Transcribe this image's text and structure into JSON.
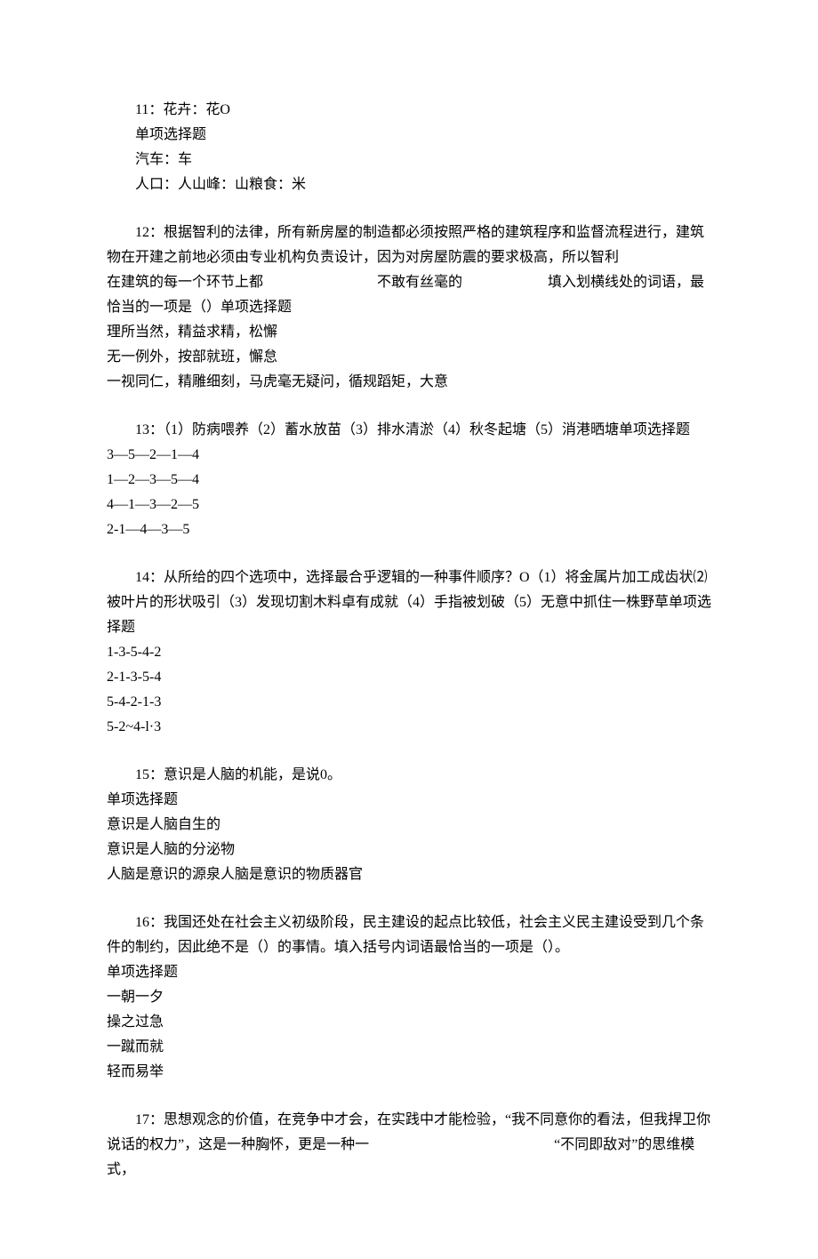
{
  "q11": {
    "l1": "11：花卉：花O",
    "l2": "单项选择题",
    "l3": "汽车：车",
    "l4": "人口：人山峰：山粮食：米"
  },
  "q12": {
    "l1": "12：根据智利的法律，所有新房屋的制造都必须按照严格的建筑程序和监督流程进行，建筑物在开建之前地必须由专业机构负责设计，因为对房屋防震的要求极高，所以智利",
    "l2": "在建筑的每一个环节上都　　　　　　　　不敢有丝毫的　　　　　　填入划横线处的词语，最恰当的一项是（）单项选择题",
    "l3": "理所当然，精益求精，松懈",
    "l4": "无一例外，按部就班，懈怠",
    "l5": "一视同仁，精雕细刻，马虎毫无疑问，循规蹈矩，大意"
  },
  "q13": {
    "l1": "13：（1）防病喂养（2）蓄水放苗（3）排水清淤（4）秋冬起塘（5）消港晒塘单项选择题",
    "l2": "3—5—2—1—4",
    "l3": "1—2—3—5—4",
    "l4": "4—1—3—2—5",
    "l5": "2-1—4—3—5"
  },
  "q14": {
    "l1": "14：从所给的四个选项中，选择最合乎逻辑的一种事件顺序？O（1）将金属片加工成齿状⑵被叶片的形状吸引（3）发现切割木料卓有成就（4）手指被划破（5）无意中抓住一株野草单项选择题",
    "l2": "1-3-5-4-2",
    "l3": "2-1-3-5-4",
    "l4": "5-4-2-1-3",
    "l5": "5-2~4-l·3"
  },
  "q15": {
    "l1": "15：意识是人脑的机能，是说0。",
    "l2": "单项选择题",
    "l3": "意识是人脑自生的",
    "l4": "意识是人脑的分泌物",
    "l5": "人脑是意识的源泉人脑是意识的物质器官"
  },
  "q16": {
    "l1": "16：我国还处在社会主义初级阶段，民主建设的起点比较低，社会主义民主建设受到几个条件的制约，因此绝不是（）的事情。填入括号内词语最恰当的一项是（）。",
    "l2": "单项选择题",
    "l3": "一朝一夕",
    "l4": "操之过急",
    "l5": "一蹴而就",
    "l6": "轻而易举"
  },
  "q17": {
    "l1": "17：思想观念的价值，在竞争中才会，在实践中才能检验，“我不同意你的看法，但我捍卫你说话的权力”，这是一种胸怀，更是一种一　　　　　　　　　　　　　“不同即敌对”的思维模式，"
  }
}
